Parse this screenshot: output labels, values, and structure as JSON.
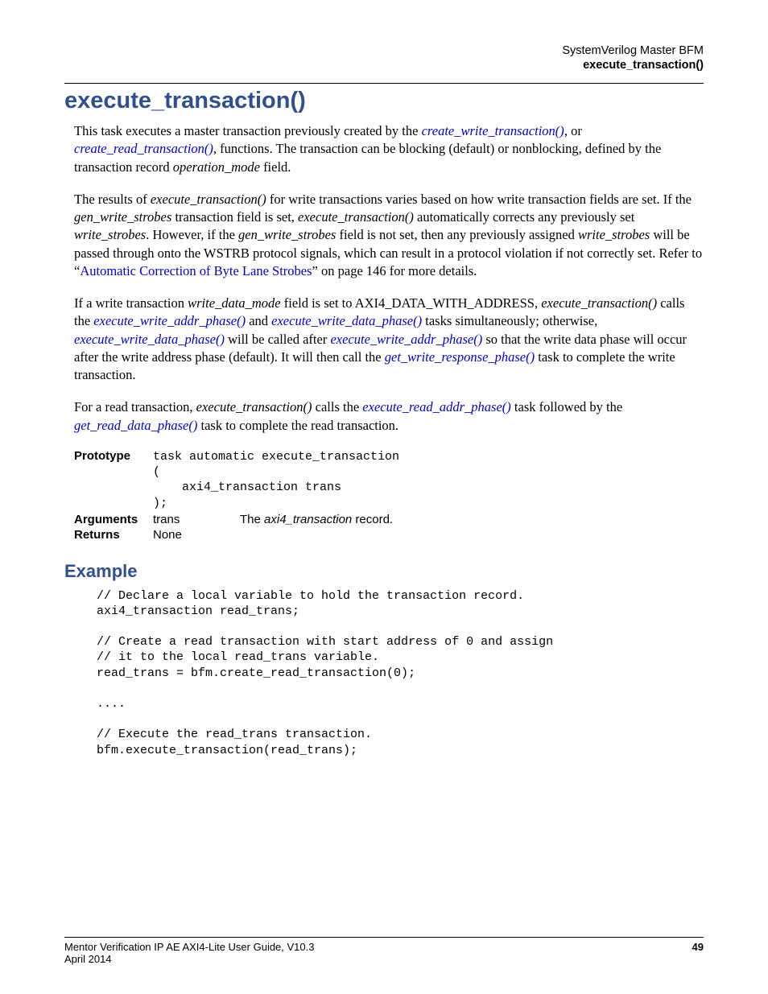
{
  "header": {
    "chapter": "SystemVerilog Master BFM",
    "topic": "execute_transaction()"
  },
  "title": "execute_transaction()",
  "paragraphs": {
    "p1_a": "This task executes a master transaction previously created by the ",
    "link_cwt": "create_write_transaction()",
    "p1_b": ", or ",
    "link_crt": "create_read_transaction()",
    "p1_c": ", functions. The transaction can be blocking (default) or nonblocking, defined by the transaction record ",
    "p1_op": "operation_mode",
    "p1_d": " field.",
    "p2_a": "The results of ",
    "p2_et1": "execute_transaction()",
    "p2_b": " for write transactions varies based on how write transaction fields are set. If the ",
    "p2_gws1": "gen_write_strobes",
    "p2_c": " transaction field is set, ",
    "p2_et2": "execute_transaction()",
    "p2_d": " automatically corrects any previously set ",
    "p2_ws1": "write_strobes",
    "p2_e": ". However, if the ",
    "p2_gws2": "gen_write_strobes",
    "p2_f": " field is not set, then any previously assigned ",
    "p2_ws2": "write_strobes",
    "p2_g": " will be passed through onto the WSTRB protocol signals, which can result in a protocol violation if not correctly set. Refer to “",
    "p2_link": "Automatic Correction of Byte Lane Strobes",
    "p2_h": "” on page 146 for more details.",
    "p3_a": " If a write transaction ",
    "p3_wdm": "write_data_mode",
    "p3_b": " field is set to AXI4_DATA_WITH_ADDRESS, ",
    "p3_et": "execute_transaction()",
    "p3_c": " calls the ",
    "p3_link_ewap": "execute_write_addr_phase()",
    "p3_d": " and ",
    "p3_link_ewdp": "execute_write_data_phase()",
    "p3_e": " tasks simultaneously; otherwise, ",
    "p3_link_ewdp2": "execute_write_data_phase()",
    "p3_f": " will be called after ",
    "p3_link_ewap2": "execute_write_addr_phase()",
    "p3_g": " so that the write data phase will occur after the write address phase (default). It will then call the ",
    "p3_link_gwrp": "get_write_response_phase()",
    "p3_h": " task to complete the write transaction.",
    "p4_a": "For a read transaction, ",
    "p4_et": "execute_transaction()",
    "p4_b": " calls the ",
    "p4_link_erap": "execute_read_addr_phase()",
    "p4_c": " task followed by the ",
    "p4_link_grdp": "get_read_data_phase()",
    "p4_d": " task to complete the read transaction."
  },
  "api": {
    "prototype_label": "Prototype",
    "prototype_code": "task automatic execute_transaction\n(\n    axi4_transaction trans\n);",
    "arguments_label": "Arguments",
    "arg_name": "trans",
    "arg_desc_a": "The ",
    "arg_desc_ital": "axi4_transaction",
    "arg_desc_b": " record.",
    "returns_label": "Returns",
    "returns_value": "None"
  },
  "example": {
    "heading": "Example",
    "code": "// Declare a local variable to hold the transaction record.\naxi4_transaction read_trans;\n\n// Create a read transaction with start address of 0 and assign\n// it to the local read_trans variable.\nread_trans = bfm.create_read_transaction(0);\n\n....\n\n// Execute the read_trans transaction.\nbfm.execute_transaction(read_trans);"
  },
  "footer": {
    "guide": "Mentor Verification IP AE AXI4-Lite User Guide, V10.3",
    "date": "April 2014",
    "page": "49"
  }
}
